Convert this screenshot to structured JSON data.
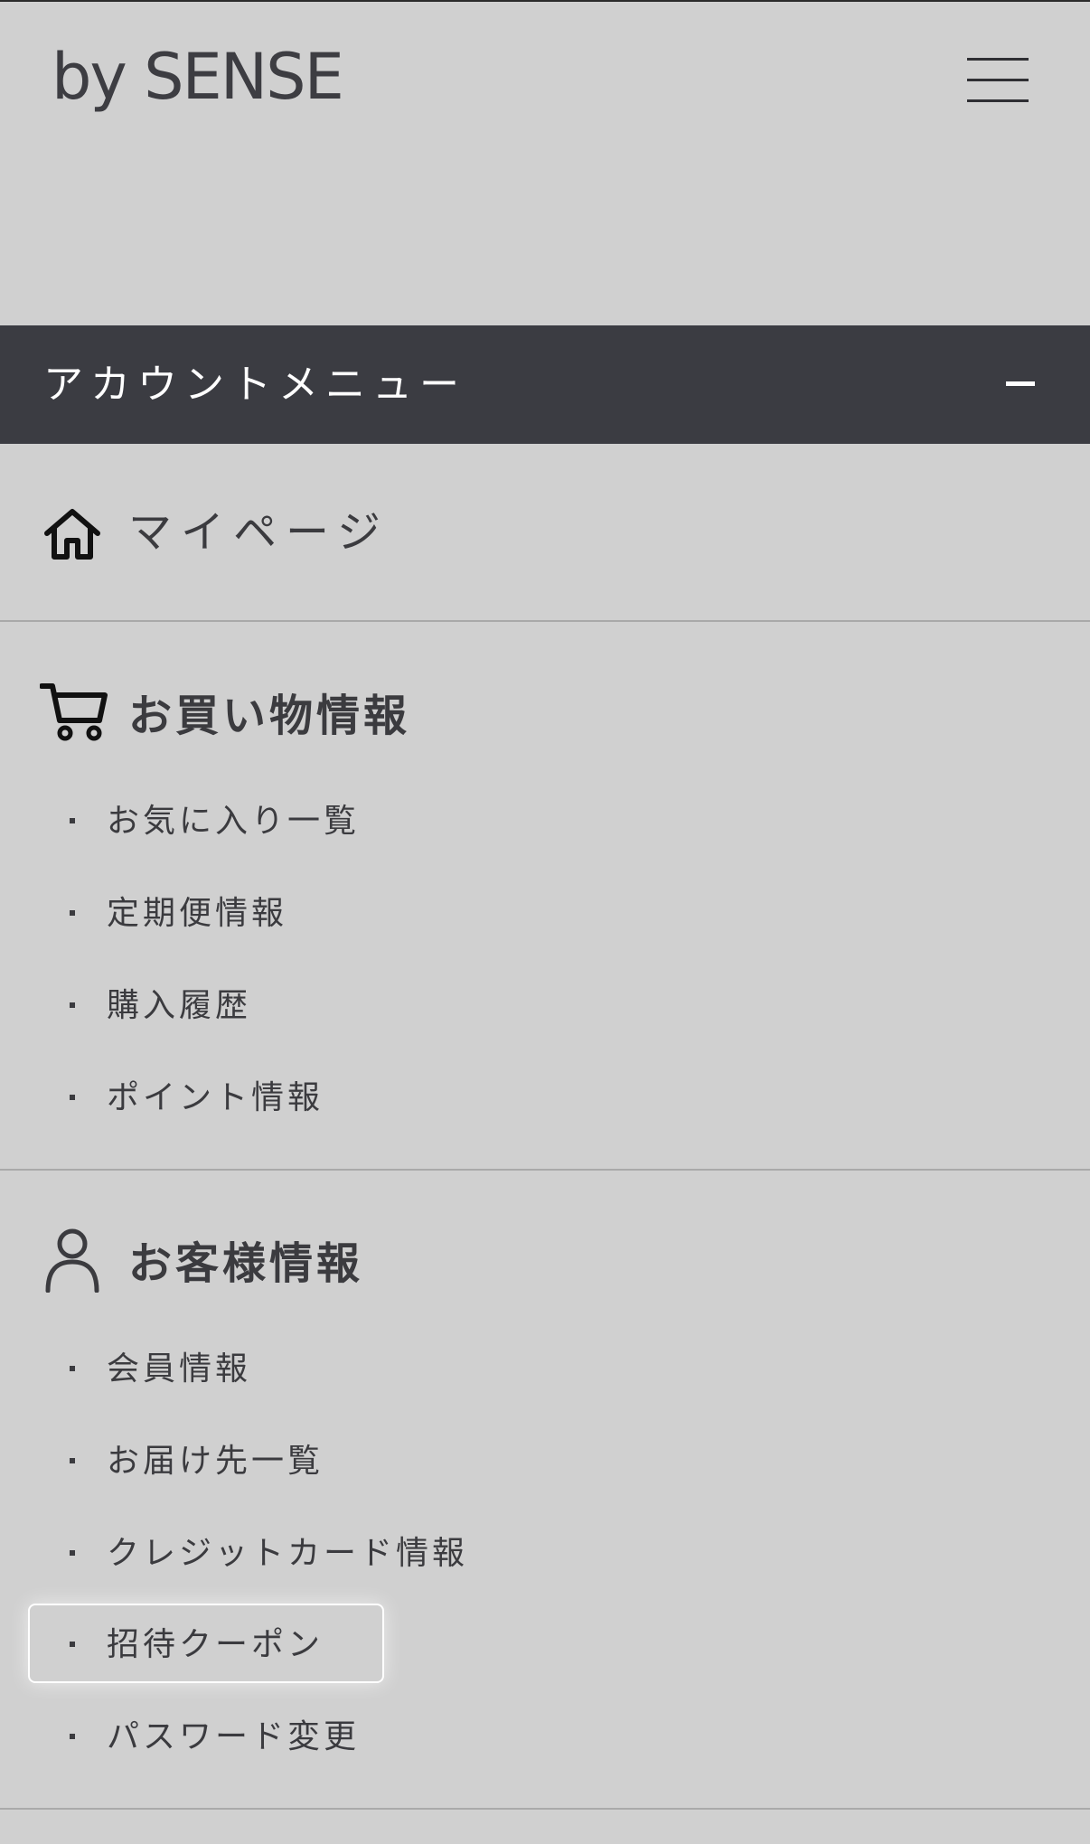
{
  "header": {
    "logo": "by SENSE",
    "menu_icon": "hamburger-menu-icon"
  },
  "account_menu": {
    "title": "アカウントメニュー",
    "toggle_icon": "minus-icon"
  },
  "mypage": {
    "label": "マイページ",
    "icon": "home-icon"
  },
  "shopping": {
    "title": "お買い物情報",
    "icon": "cart-icon",
    "items": [
      {
        "label": "お気に入り一覧"
      },
      {
        "label": "定期便情報"
      },
      {
        "label": "購入履歴"
      },
      {
        "label": "ポイント情報"
      }
    ]
  },
  "customer": {
    "title": "お客様情報",
    "icon": "user-icon",
    "items": [
      {
        "label": "会員情報"
      },
      {
        "label": "お届け先一覧"
      },
      {
        "label": "クレジットカード情報"
      },
      {
        "label": "招待クーポン"
      },
      {
        "label": "パスワード変更"
      }
    ]
  },
  "colors": {
    "background": "#d0d0d0",
    "account_bar": "#3b3c42",
    "text": "#3b3b3f",
    "divider": "#a9a9a9"
  }
}
